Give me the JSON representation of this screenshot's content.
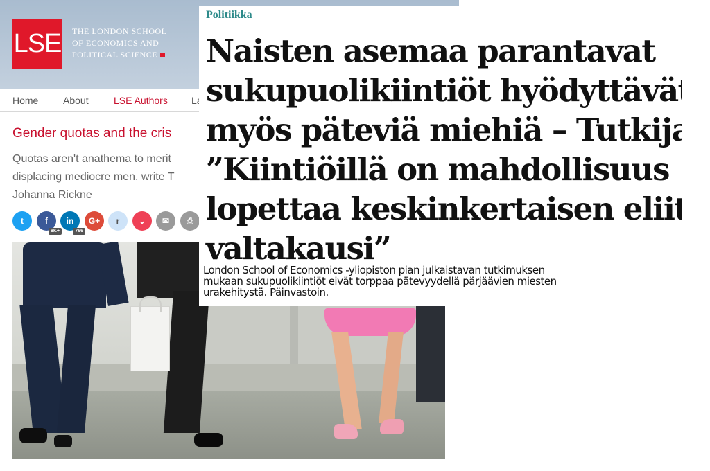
{
  "lse": {
    "logo_text": "LSE",
    "name_lines": [
      "THE LONDON SCHOOL",
      "OF ECONOMICS AND",
      "POLITICAL SCIENCE"
    ],
    "nav": [
      "Home",
      "About",
      "LSE Authors",
      "La"
    ],
    "article_title": "Gender quotas and the cris",
    "subtitle_lines": [
      "Quotas aren't anathema to merit",
      "displacing mediocre men, write T",
      "Johanna Rickne"
    ],
    "share": [
      {
        "icon": "twitter-icon",
        "glyph": "t",
        "color": "#1da1f2",
        "count": ""
      },
      {
        "icon": "facebook-icon",
        "glyph": "f",
        "color": "#3b5998",
        "count": "8K+"
      },
      {
        "icon": "linkedin-icon",
        "glyph": "in",
        "color": "#0077b5",
        "count": "766"
      },
      {
        "icon": "googleplus-icon",
        "glyph": "G+",
        "color": "#dd4b39",
        "count": ""
      },
      {
        "icon": "reddit-icon",
        "glyph": "r",
        "color": "#cee3f8",
        "count": ""
      },
      {
        "icon": "pocket-icon",
        "glyph": "⌄",
        "color": "#ef4056",
        "count": ""
      },
      {
        "icon": "email-icon",
        "glyph": "✉",
        "color": "#9a9a9a",
        "count": ""
      },
      {
        "icon": "print-icon",
        "glyph": "⎙",
        "color": "#9a9a9a",
        "count": ""
      }
    ],
    "accent": "#c8102e"
  },
  "clipping": {
    "category": "Politiikka",
    "headline_lines": [
      "Naisten asemaa parantavat",
      "sukupuolikiintiöt hyödyttävät",
      "myös päteviä miehiä – Tutkijat:",
      "”Kiintiöillä on mahdollisuus",
      "lopettaa keskinkertaisen eliitin",
      "valtakausi”"
    ],
    "lead_lines": [
      "London School of Economics -yliopiston pian julkaistavan tutkimuksen",
      "mukaan sukupuolikiintiöt eivät torppaa pätevyydellä pärjäävien miesten",
      "urakehitystä. Päinvastoin."
    ],
    "category_color": "#2d8a8a"
  }
}
